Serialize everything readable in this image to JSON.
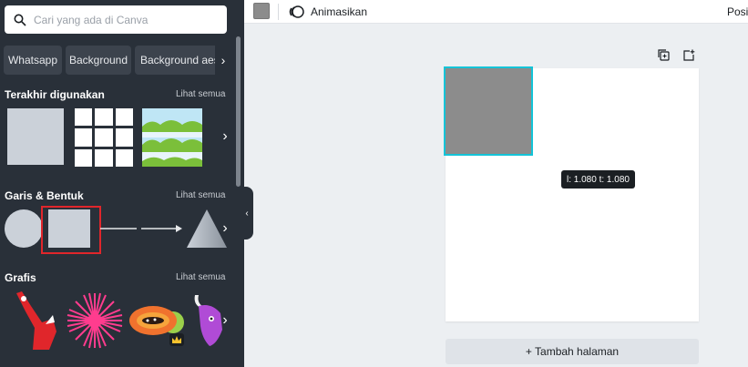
{
  "search": {
    "placeholder": "Cari yang ada di Canva"
  },
  "chips": [
    "Whatsapp",
    "Background",
    "Background aes"
  ],
  "sections": {
    "recent": {
      "title": "Terakhir digunakan",
      "link": "Lihat semua"
    },
    "shapes": {
      "title": "Garis & Bentuk",
      "link": "Lihat semua"
    },
    "graphics": {
      "title": "Grafis",
      "link": "Lihat semua"
    }
  },
  "toolbar": {
    "animate_label": "Animasikan",
    "position_label": "Posi"
  },
  "canvas": {
    "size_tooltip": "l: 1.080 t: 1.080",
    "add_page_label": "+ Tambah halaman"
  },
  "colors": {
    "panel_bg": "#293039",
    "selected_shape_color": "#8c8c8c",
    "selection_outline": "#12c4d8",
    "highlight_box": "#e0262b"
  }
}
